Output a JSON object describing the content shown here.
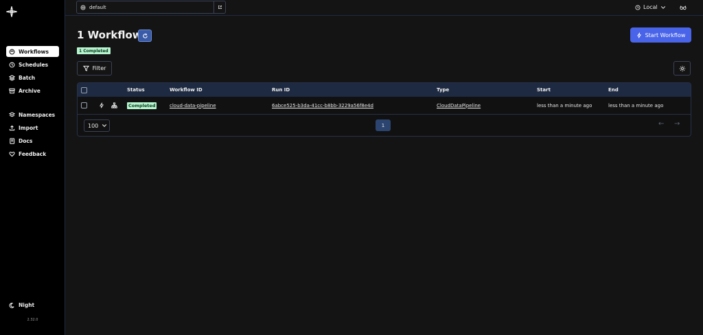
{
  "sidebar": {
    "items": [
      {
        "label": "Workflows",
        "icon": "workflows-icon",
        "active": true
      },
      {
        "label": "Schedules",
        "icon": "clock-icon"
      },
      {
        "label": "Batch",
        "icon": "layers-icon"
      },
      {
        "label": "Archive",
        "icon": "archive-icon"
      }
    ],
    "items2": [
      {
        "label": "Namespaces",
        "icon": "namespaces-icon"
      },
      {
        "label": "Import",
        "icon": "upload-icon"
      },
      {
        "label": "Docs",
        "icon": "book-icon"
      },
      {
        "label": "Feedback",
        "icon": "heart-icon"
      }
    ],
    "theme_label": "Night",
    "version": "2.32.0"
  },
  "topbar": {
    "namespace": "default",
    "environment": "Local"
  },
  "page": {
    "title": "1 Workflow",
    "count_badge": "1 Completed",
    "start_button": "Start Workflow",
    "filter_button": "Filter"
  },
  "table": {
    "headers": [
      "Status",
      "Workflow ID",
      "Run ID",
      "Type",
      "Start",
      "End"
    ],
    "rows": [
      {
        "status": "Completed",
        "workflow_id": "cloud-data-pipeline",
        "run_id": "6abce525-b3da-41cc-b8bb-3229a56f8e4d",
        "type": "CloudDataPipeline",
        "start": "less than a minute ago",
        "end": "less than a minute ago"
      }
    ],
    "per_page": "100",
    "current_page": "1"
  },
  "colors": {
    "accent": "#4964e8",
    "status_completed_bg": "#b7f5cf",
    "header_bg": "#1e2a41"
  }
}
